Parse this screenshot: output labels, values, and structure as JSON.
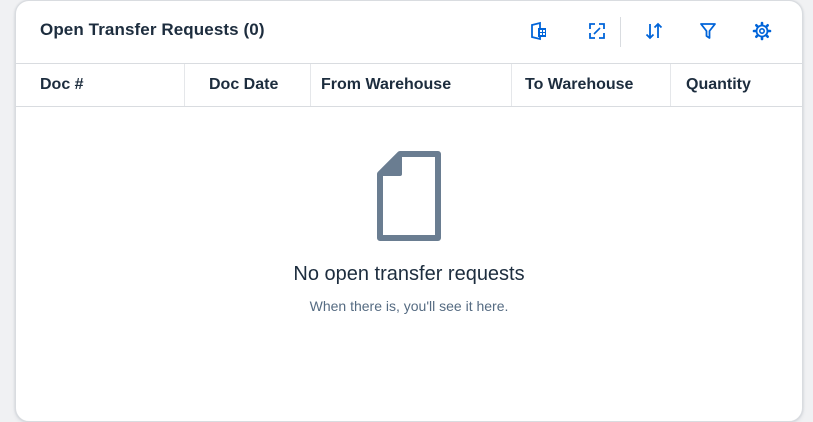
{
  "card": {
    "title": "Open Transfer Requests (0)"
  },
  "toolbar": {
    "buttons": [
      {
        "name": "export-to-spreadsheet",
        "icon": "excel-export-icon"
      },
      {
        "name": "fullscreen",
        "icon": "expand-icon"
      },
      {
        "name": "sort",
        "icon": "sort-icon"
      },
      {
        "name": "filter",
        "icon": "filter-icon"
      },
      {
        "name": "settings",
        "icon": "gear-icon"
      }
    ],
    "icon_color": "#0064d9"
  },
  "table": {
    "columns": [
      "Doc #",
      "Doc Date",
      "From Warehouse",
      "To Warehouse",
      "Quantity"
    ]
  },
  "empty_state": {
    "icon": "document-icon",
    "title": "No open transfer requests",
    "subtitle": "When there is, you'll see it here."
  },
  "colors": {
    "text": "#1d2d3e",
    "muted": "#556b82",
    "accent": "#0064d9",
    "icon_grey": "#6a7d91"
  }
}
